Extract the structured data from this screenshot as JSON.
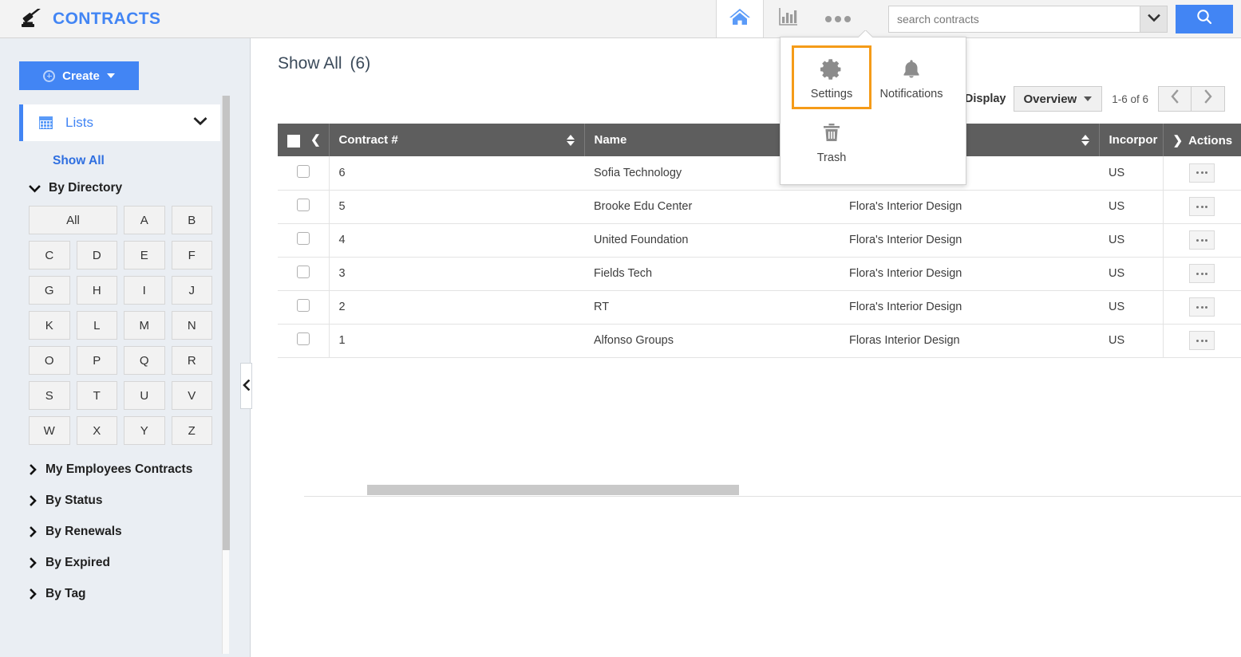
{
  "app": {
    "brand": "CONTRACTS",
    "brand_color": "#4285f4",
    "logo_icon": "gavel-icon"
  },
  "topbar": {
    "home_icon": "home-icon",
    "chart_icon": "bar-chart-icon",
    "more_icon": "ellipsis-icon",
    "search": {
      "placeholder": "search contracts",
      "value": "",
      "caret_icon": "chevron-down-icon",
      "submit_icon": "search-icon"
    }
  },
  "popup_menu": {
    "visible": true,
    "highlight_color": "#f59b18",
    "items": [
      {
        "label": "Settings",
        "icon": "gear-icon",
        "selected": true
      },
      {
        "label": "Notifications",
        "icon": "bell-icon",
        "selected": false
      },
      {
        "label": "Trash",
        "icon": "trash-icon",
        "selected": false
      }
    ]
  },
  "sidebar": {
    "create_label": "Create",
    "create_icon": "plus-circle-icon",
    "create_caret": "caret-down-icon",
    "lists": {
      "label": "Lists",
      "icon": "grid-icon",
      "chevron": "chevron-down-icon",
      "active": true
    },
    "show_all_label": "Show All",
    "by_directory": {
      "label": "By Directory",
      "chevron": "chevron-down-icon",
      "letters": [
        "All",
        "A",
        "B",
        "C",
        "D",
        "E",
        "F",
        "G",
        "H",
        "I",
        "J",
        "K",
        "L",
        "M",
        "N",
        "O",
        "P",
        "Q",
        "R",
        "S",
        "T",
        "U",
        "V",
        "W",
        "X",
        "Y",
        "Z"
      ]
    },
    "nav_items": [
      {
        "label": "My Employees Contracts",
        "chevron": "chevron-right-icon"
      },
      {
        "label": "By Status",
        "chevron": "chevron-right-icon"
      },
      {
        "label": "By Renewals",
        "chevron": "chevron-right-icon"
      },
      {
        "label": "By Expired",
        "chevron": "chevron-right-icon"
      },
      {
        "label": "By Tag",
        "chevron": "chevron-right-icon"
      }
    ],
    "collapse_icon": "chevron-left-icon"
  },
  "main": {
    "title": "Show All",
    "count": "(6)",
    "display_label": "Display",
    "display_value": "Overview",
    "display_caret": "caret-down-icon",
    "range": "1-6 of 6",
    "prev_icon": "chevron-left-icon",
    "next_icon": "chevron-right-icon"
  },
  "table": {
    "header_checkbox": "select-all-checkbox",
    "header_collapse_icon": "chevron-left-icon",
    "actions_expand_icon": "chevron-right-icon",
    "columns": [
      {
        "key": "contract_no",
        "label": "Contract #",
        "sortable": true
      },
      {
        "key": "name",
        "label": "Name",
        "sortable": false
      },
      {
        "key": "company",
        "label": "",
        "sortable": true
      },
      {
        "key": "incorp",
        "label": "Incorpor",
        "sortable": false
      },
      {
        "key": "actions",
        "label": "Actions",
        "sortable": false
      }
    ],
    "rows": [
      {
        "contract_no": "6",
        "name": "Sofia Technology",
        "company": "",
        "incorp": "US"
      },
      {
        "contract_no": "5",
        "name": "Brooke Edu Center",
        "company": "Flora's Interior Design",
        "incorp": "US"
      },
      {
        "contract_no": "4",
        "name": "United Foundation",
        "company": "Flora's Interior Design",
        "incorp": "US"
      },
      {
        "contract_no": "3",
        "name": "Fields Tech",
        "company": "Flora's Interior Design",
        "incorp": "US"
      },
      {
        "contract_no": "2",
        "name": "RT",
        "company": "Flora's Interior Design",
        "incorp": "US"
      },
      {
        "contract_no": "1",
        "name": "Alfonso Groups",
        "company": "Floras Interior Design",
        "incorp": "US"
      }
    ],
    "row_action_icon": "ellipsis-icon"
  }
}
